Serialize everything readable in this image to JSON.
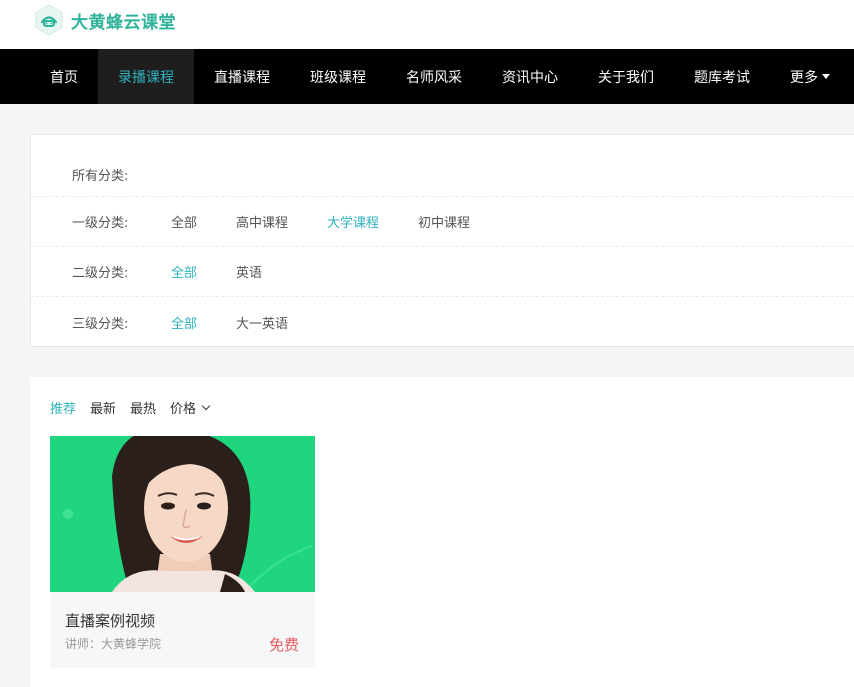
{
  "brand": {
    "name": "大黄蜂云课堂",
    "color": "#2fb39b",
    "icon": "logo-icon"
  },
  "nav": {
    "items": [
      {
        "label": "首页",
        "active": false
      },
      {
        "label": "录播课程",
        "active": true
      },
      {
        "label": "直播课程",
        "active": false
      },
      {
        "label": "班级课程",
        "active": false
      },
      {
        "label": "名师风采",
        "active": false
      },
      {
        "label": "资讯中心",
        "active": false
      },
      {
        "label": "关于我们",
        "active": false
      },
      {
        "label": "题库考试",
        "active": false
      }
    ],
    "more_label": "更多",
    "accent_color": "#2fb3bf"
  },
  "filters": {
    "all_label": "所有分类:",
    "rows": [
      {
        "label": "一级分类:",
        "options": [
          "全部",
          "高中课程",
          "大学课程",
          "初中课程"
        ],
        "active_index": 2
      },
      {
        "label": "二级分类:",
        "options": [
          "全部",
          "英语"
        ],
        "active_index": 0
      },
      {
        "label": "三级分类:",
        "options": [
          "全部",
          "大一英语"
        ],
        "active_index": 0
      }
    ]
  },
  "sort": {
    "items": [
      "推荐",
      "最新",
      "最热"
    ],
    "price_label": "价格",
    "active_index": 0
  },
  "courses": [
    {
      "title": "直播案例视频",
      "teacher": "讲师：大黄蜂学院",
      "price": "免费",
      "thumb_color": "#1fd67e"
    }
  ]
}
